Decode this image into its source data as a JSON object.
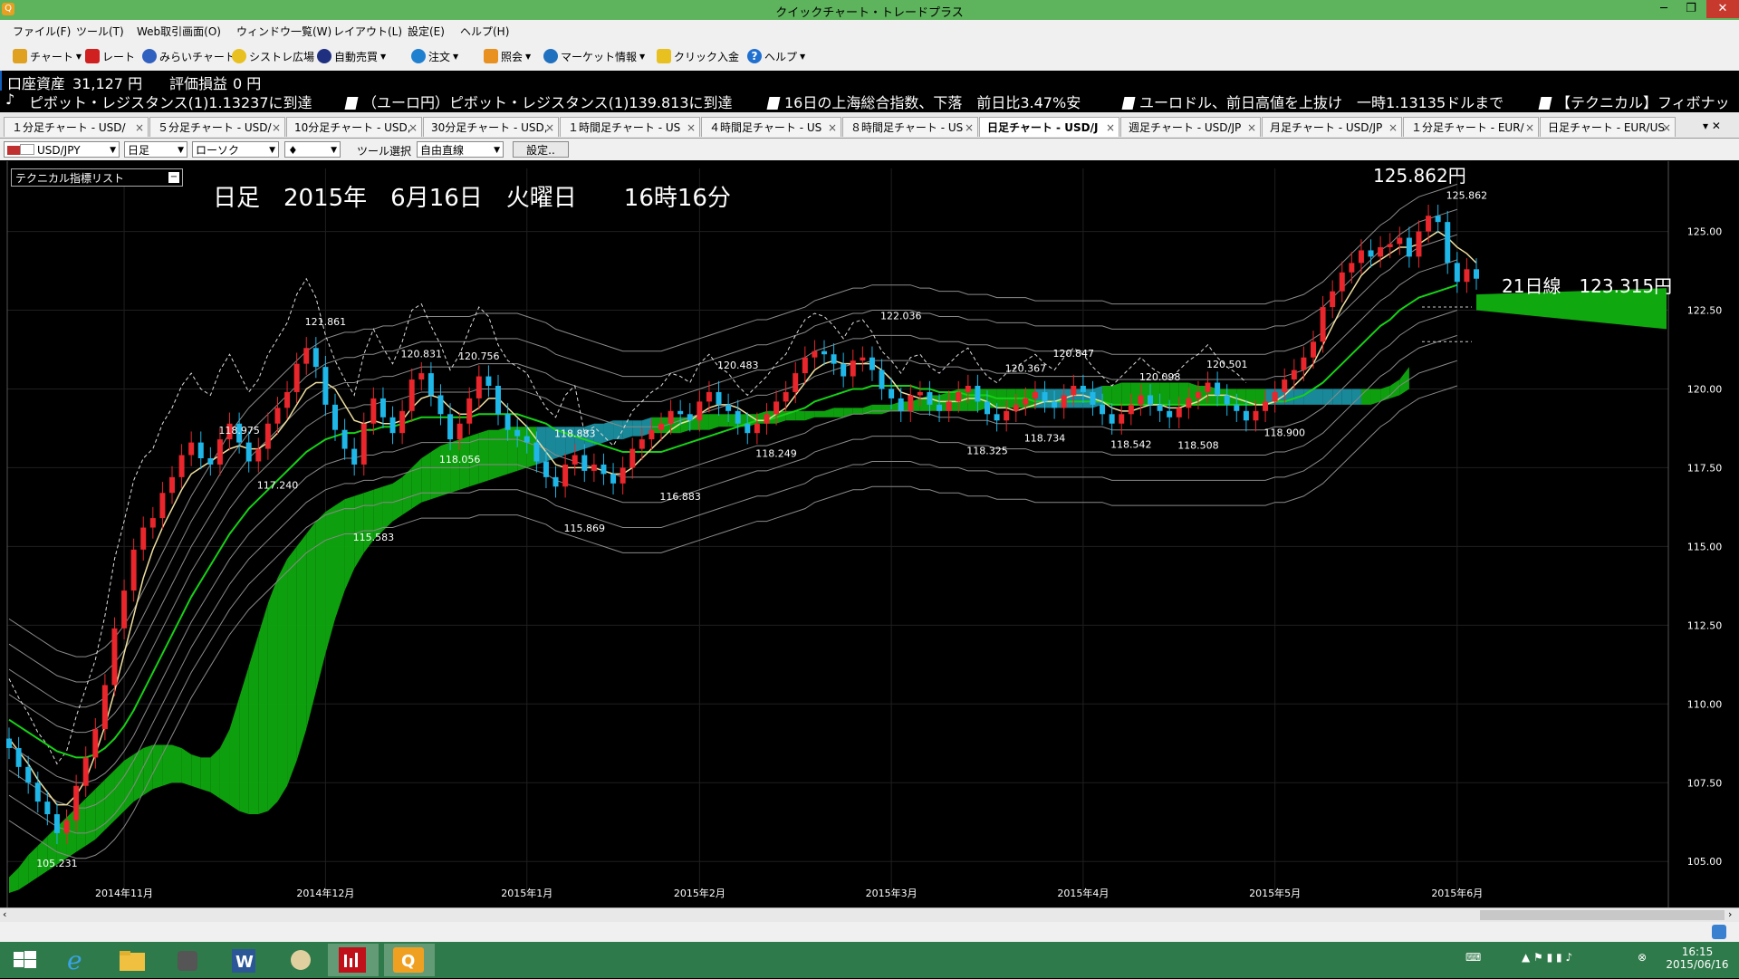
{
  "window": {
    "title": "クイックチャート・トレードプラス",
    "app_icon": "Q"
  },
  "menu": [
    "ファイル(F)",
    "ツール(T)",
    "Web取引画面(O)",
    "ウィンドウ一覧(W)",
    "レイアウト(L)",
    "設定(E)",
    "ヘルプ(H)"
  ],
  "toolbar": [
    "チャート",
    "レート",
    "みらいチャート",
    "シストレ広場",
    "自動売買",
    "注文",
    "照会",
    "マーケット情報",
    "クリック入金",
    "ヘルプ"
  ],
  "account": {
    "label": "口座資産",
    "value": "31,127 円",
    "pl_label": "評価損益",
    "pl_value": "0 円"
  },
  "ticker": [
    "ピボット・レジスタンス(1)1.13237に到達",
    "（ユーロ円）ピボット・レジスタンス(1)139.813に到達",
    "16日の上海総合指数、下落　前日比3.47%安",
    "ユーロドル、前日高値を上抜け　一時1.13135ドルまで",
    "【テクニカル】フィボナッ"
  ],
  "ticker_lead": "♪",
  "tabs": [
    "１分足チャート - USD/",
    "５分足チャート - USD/",
    "10分足チャート - USD,",
    "30分足チャート - USD,",
    "１時間足チャート - US",
    "４時間足チャート - US",
    "８時間足チャート - US",
    "日足チャート - USD/J",
    "週足チャート - USD/JP",
    "月足チャート - USD/JP",
    "１分足チャート - EUR/",
    "日足チャート - EUR/US"
  ],
  "active_tab": 7,
  "controls": {
    "pair": "USD/JPY",
    "period": "日足",
    "candle": "ローソク",
    "marker": "♦",
    "tool_label": "ツール選択",
    "tool": "自由直線",
    "settings": "設定.."
  },
  "indicator_list": "テクニカル指標リスト",
  "chart_header": "日足　2015年　6月16日　火曜日　　16時16分",
  "last_price_label": "125.862円",
  "ma_label": "21日線　123.315円",
  "chart_data": {
    "type": "line",
    "title": "日足　2015年　6月16日　火曜日　　16時16分",
    "pair": "USD/JPY",
    "y_ticks": [
      "125.00",
      "122.50",
      "120.00",
      "117.50",
      "115.00",
      "112.50",
      "110.00",
      "107.50",
      "105.00"
    ],
    "ylim": [
      104.0,
      127.0
    ],
    "x_ticks": [
      "2014年11月",
      "2014年12月",
      "2015年1月",
      "2015年2月",
      "2015年3月",
      "2015年4月",
      "2015年5月",
      "2015年6月"
    ],
    "x_tick_index": [
      12,
      33,
      54,
      72,
      92,
      112,
      132,
      151
    ],
    "point_labels": [
      {
        "text": "105.231",
        "i": 5,
        "v": 105.23
      },
      {
        "text": "118.975",
        "i": 24,
        "v": 118.98
      },
      {
        "text": "117.240",
        "i": 28,
        "v": 117.24
      },
      {
        "text": "121.861",
        "i": 33,
        "v": 121.86
      },
      {
        "text": "115.583",
        "i": 38,
        "v": 115.58
      },
      {
        "text": "120.831",
        "i": 43,
        "v": 120.83
      },
      {
        "text": "118.056",
        "i": 47,
        "v": 118.06
      },
      {
        "text": "120.756",
        "i": 49,
        "v": 120.76
      },
      {
        "text": "118.883",
        "i": 59,
        "v": 118.88
      },
      {
        "text": "115.869",
        "i": 60,
        "v": 115.87
      },
      {
        "text": "116.883",
        "i": 70,
        "v": 116.88
      },
      {
        "text": "120.483",
        "i": 76,
        "v": 120.48
      },
      {
        "text": "118.249",
        "i": 80,
        "v": 118.25
      },
      {
        "text": "122.036",
        "i": 93,
        "v": 122.04
      },
      {
        "text": "118.325",
        "i": 102,
        "v": 118.33
      },
      {
        "text": "120.367",
        "i": 106,
        "v": 120.37
      },
      {
        "text": "118.734",
        "i": 108,
        "v": 118.73
      },
      {
        "text": "120.847",
        "i": 111,
        "v": 120.85
      },
      {
        "text": "118.542",
        "i": 117,
        "v": 118.54
      },
      {
        "text": "120.098",
        "i": 120,
        "v": 120.1
      },
      {
        "text": "118.508",
        "i": 124,
        "v": 118.51
      },
      {
        "text": "120.501",
        "i": 127,
        "v": 120.5
      },
      {
        "text": "118.900",
        "i": 133,
        "v": 118.9
      },
      {
        "text": "125.862",
        "i": 152,
        "v": 125.86
      }
    ],
    "close": [
      108.6,
      108.0,
      107.5,
      106.9,
      106.5,
      105.9,
      106.3,
      107.4,
      108.3,
      109.2,
      110.6,
      112.4,
      113.6,
      114.9,
      115.6,
      115.9,
      116.7,
      117.2,
      117.9,
      118.3,
      117.8,
      117.6,
      118.4,
      118.9,
      118.3,
      117.7,
      118.1,
      118.9,
      119.4,
      119.9,
      120.8,
      121.3,
      120.7,
      119.5,
      118.7,
      118.1,
      117.6,
      118.9,
      119.7,
      119.1,
      118.6,
      119.3,
      120.3,
      120.5,
      119.8,
      119.2,
      118.4,
      118.9,
      119.7,
      120.4,
      120.1,
      119.2,
      118.7,
      118.5,
      118.3,
      117.7,
      117.2,
      116.9,
      117.6,
      117.9,
      117.4,
      117.6,
      117.3,
      117.0,
      117.5,
      118.1,
      118.4,
      118.7,
      118.9,
      119.3,
      119.2,
      119.0,
      119.6,
      119.9,
      119.5,
      119.3,
      118.9,
      118.6,
      118.9,
      119.2,
      119.6,
      119.9,
      120.5,
      121.0,
      121.2,
      121.1,
      120.8,
      120.4,
      120.9,
      121.0,
      120.6,
      120.0,
      119.7,
      119.3,
      119.8,
      119.9,
      119.5,
      119.3,
      119.6,
      119.9,
      120.1,
      119.6,
      119.2,
      119.0,
      119.3,
      119.5,
      119.7,
      119.9,
      119.6,
      119.4,
      119.8,
      120.1,
      119.9,
      119.5,
      119.2,
      118.9,
      119.2,
      119.5,
      119.8,
      119.5,
      119.3,
      119.1,
      119.4,
      119.7,
      119.9,
      120.2,
      119.8,
      119.5,
      119.3,
      119.0,
      119.3,
      119.6,
      119.9,
      120.3,
      120.6,
      121.0,
      121.5,
      122.6,
      123.1,
      123.7,
      124.0,
      124.4,
      124.2,
      124.5,
      124.6,
      124.8,
      124.2,
      125.0,
      125.5,
      125.3,
      124.0,
      123.4,
      123.8,
      123.5
    ],
    "ma_fast": [
      108.9,
      108.5,
      108.1,
      107.6,
      107.2,
      106.8,
      106.8,
      107.1,
      107.6,
      108.4,
      109.3,
      110.4,
      111.6,
      112.8,
      114.0,
      114.9,
      115.6,
      116.2,
      116.8,
      117.3,
      117.5,
      117.7,
      117.9,
      118.1,
      118.2,
      118.1,
      118.1,
      118.3,
      118.6,
      119.0,
      119.5,
      120.0,
      120.2,
      120.2,
      120.0,
      119.5,
      119.0,
      118.9,
      119.0,
      118.9,
      118.9,
      119.0,
      119.4,
      119.7,
      119.8,
      119.7,
      119.4,
      119.2,
      119.2,
      119.4,
      119.7,
      119.7,
      119.4,
      119.1,
      118.8,
      118.4,
      118.0,
      117.6,
      117.5,
      117.5,
      117.5,
      117.5,
      117.4,
      117.3,
      117.3,
      117.5,
      117.8,
      118.1,
      118.4,
      118.7,
      118.9,
      119.0,
      119.2,
      119.4,
      119.5,
      119.5,
      119.4,
      119.2,
      119.0,
      119.0,
      119.2,
      119.4,
      119.8,
      120.2,
      120.6,
      120.8,
      120.9,
      120.8,
      120.8,
      120.8,
      120.8,
      120.6,
      120.3,
      119.9,
      119.8,
      119.7,
      119.7,
      119.6,
      119.6,
      119.6,
      119.7,
      119.7,
      119.6,
      119.4,
      119.4,
      119.3,
      119.4,
      119.5,
      119.6,
      119.6,
      119.7,
      119.8,
      119.8,
      119.7,
      119.6,
      119.4,
      119.3,
      119.3,
      119.4,
      119.5,
      119.5,
      119.4,
      119.4,
      119.5,
      119.6,
      119.8,
      119.8,
      119.8,
      119.7,
      119.6,
      119.5,
      119.5,
      119.6,
      119.8,
      120.1,
      120.4,
      120.8,
      121.4,
      122.0,
      122.6,
      123.1,
      123.6,
      123.9,
      124.1,
      124.3,
      124.5,
      124.5,
      124.6,
      124.8,
      125.0,
      124.8,
      124.5,
      124.3,
      124.0
    ],
    "ma_21": [
      109.5,
      109.3,
      109.1,
      108.9,
      108.7,
      108.5,
      108.4,
      108.3,
      108.3,
      108.4,
      108.6,
      108.9,
      109.3,
      109.8,
      110.4,
      111.0,
      111.6,
      112.2,
      112.8,
      113.4,
      113.9,
      114.4,
      114.9,
      115.4,
      115.8,
      116.2,
      116.5,
      116.8,
      117.1,
      117.4,
      117.7,
      118.0,
      118.2,
      118.4,
      118.5,
      118.6,
      118.6,
      118.7,
      118.7,
      118.8,
      118.8,
      118.9,
      119.0,
      119.1,
      119.1,
      119.1,
      119.1,
      119.1,
      119.1,
      119.2,
      119.2,
      119.2,
      119.2,
      119.2,
      119.1,
      119.0,
      118.9,
      118.7,
      118.6,
      118.5,
      118.4,
      118.3,
      118.2,
      118.1,
      118.0,
      118.0,
      118.0,
      118.0,
      118.0,
      118.1,
      118.2,
      118.3,
      118.4,
      118.5,
      118.6,
      118.7,
      118.8,
      118.9,
      119.0,
      119.0,
      119.1,
      119.2,
      119.3,
      119.4,
      119.6,
      119.7,
      119.8,
      119.9,
      120.0,
      120.0,
      120.1,
      120.1,
      120.1,
      120.1,
      120.1,
      120.0,
      120.0,
      119.9,
      119.9,
      119.9,
      119.8,
      119.8,
      119.8,
      119.7,
      119.7,
      119.7,
      119.7,
      119.6,
      119.6,
      119.6,
      119.6,
      119.6,
      119.6,
      119.6,
      119.6,
      119.5,
      119.5,
      119.5,
      119.5,
      119.5,
      119.5,
      119.5,
      119.5,
      119.5,
      119.5,
      119.5,
      119.5,
      119.5,
      119.5,
      119.5,
      119.5,
      119.5,
      119.6,
      119.6,
      119.7,
      119.8,
      120.0,
      120.2,
      120.5,
      120.8,
      121.1,
      121.4,
      121.7,
      122.0,
      122.2,
      122.5,
      122.7,
      122.9,
      123.0,
      123.1,
      123.2,
      123.3
    ],
    "cloud_top": [
      104.5,
      104.8,
      105.2,
      105.5,
      105.8,
      106.1,
      106.4,
      106.7,
      107.0,
      107.3,
      107.6,
      107.9,
      108.2,
      108.4,
      108.6,
      108.7,
      108.7,
      108.7,
      108.6,
      108.4,
      108.3,
      108.3,
      108.6,
      109.2,
      110.2,
      111.2,
      112.2,
      113.2,
      114.0,
      114.6,
      115.0,
      115.4,
      115.8,
      116.1,
      116.3,
      116.5,
      116.6,
      116.7,
      116.8,
      116.9,
      117.0,
      117.2,
      117.5,
      117.8,
      118.0,
      118.2,
      118.3,
      118.4,
      118.5,
      118.6,
      118.7,
      118.7,
      118.8,
      118.8,
      118.8,
      118.8,
      118.8,
      118.8,
      118.8,
      118.8,
      118.8,
      118.9,
      118.9,
      119.0,
      119.0,
      119.0,
      119.0,
      119.1,
      119.1,
      119.1,
      119.1,
      119.1,
      119.2,
      119.2,
      119.2,
      119.2,
      119.2,
      119.2,
      119.2,
      119.3,
      119.3,
      119.3,
      119.3,
      119.3,
      119.3,
      119.3,
      119.4,
      119.4,
      119.4,
      119.4,
      119.5,
      119.5,
      119.5,
      119.6,
      119.6,
      119.7,
      119.8,
      119.8,
      119.9,
      120.0,
      120.0,
      120.0,
      120.0,
      120.0,
      120.0,
      120.0,
      120.0,
      120.0,
      120.0,
      120.0,
      120.0,
      120.0,
      120.0,
      120.0,
      120.1,
      120.1,
      120.2,
      120.2,
      120.2,
      120.2,
      120.2,
      120.2,
      120.2,
      120.2,
      120.1,
      120.1,
      120.0,
      120.0,
      120.0,
      120.0,
      120.0,
      120.0,
      120.0,
      120.0,
      120.0,
      120.0,
      120.0,
      120.0,
      120.0,
      120.0,
      120.0,
      120.0,
      120.0,
      120.0,
      120.1,
      120.3,
      120.7,
      121.2,
      121.8,
      122.3,
      122.6,
      122.8,
      122.9,
      123.0,
      123.0,
      123.0
    ],
    "cloud_bottom": [
      104.0,
      104.1,
      104.3,
      104.5,
      104.7,
      104.9,
      105.1,
      105.3,
      105.5,
      105.7,
      106.0,
      106.3,
      106.6,
      106.9,
      107.1,
      107.3,
      107.4,
      107.5,
      107.5,
      107.4,
      107.3,
      107.2,
      107.0,
      106.8,
      106.6,
      106.5,
      106.5,
      106.6,
      106.9,
      107.4,
      108.2,
      109.2,
      110.4,
      111.6,
      112.7,
      113.6,
      114.3,
      114.8,
      115.2,
      115.5,
      115.8,
      116.0,
      116.2,
      116.4,
      116.5,
      116.6,
      116.7,
      116.8,
      116.9,
      117.0,
      117.1,
      117.2,
      117.3,
      117.4,
      117.5,
      117.6,
      117.7,
      117.8,
      117.9,
      118.0,
      118.1,
      118.2,
      118.3,
      118.4,
      118.4,
      118.5,
      118.5,
      118.6,
      118.6,
      118.6,
      118.6,
      118.7,
      118.7,
      118.7,
      118.8,
      118.8,
      118.8,
      118.8,
      118.9,
      118.9,
      118.9,
      119.0,
      119.0,
      119.0,
      119.1,
      119.1,
      119.1,
      119.1,
      119.2,
      119.2,
      119.2,
      119.2,
      119.3,
      119.3,
      119.3,
      119.3,
      119.3,
      119.3,
      119.3,
      119.3,
      119.3,
      119.3,
      119.4,
      119.4,
      119.4,
      119.4,
      119.4,
      119.4,
      119.4,
      119.4,
      119.4,
      119.4,
      119.4,
      119.4,
      119.5,
      119.5,
      119.5,
      119.5,
      119.5,
      119.5,
      119.5,
      119.5,
      119.5,
      119.5,
      119.5,
      119.5,
      119.5,
      119.5,
      119.5,
      119.5,
      119.5,
      119.5,
      119.5,
      119.5,
      119.5,
      119.5,
      119.5,
      119.5,
      119.5,
      119.5,
      119.5,
      119.5,
      119.5,
      119.6,
      119.7,
      119.8,
      120.0,
      120.2,
      120.6,
      121.0,
      121.5,
      122.0,
      122.3,
      122.5,
      122.6,
      122.6
    ]
  },
  "taskbar": {
    "time": "16:15",
    "date": "2015/06/16"
  },
  "colors": {
    "title_green": "#5eb35d",
    "bull": "#e8262b",
    "bear": "#1fb6e8",
    "cloud_bull": "#0fa80f",
    "cloud_bear": "#1a8fa0",
    "ma_21": "#17d117",
    "ma_fast": "#f0e0a0"
  }
}
